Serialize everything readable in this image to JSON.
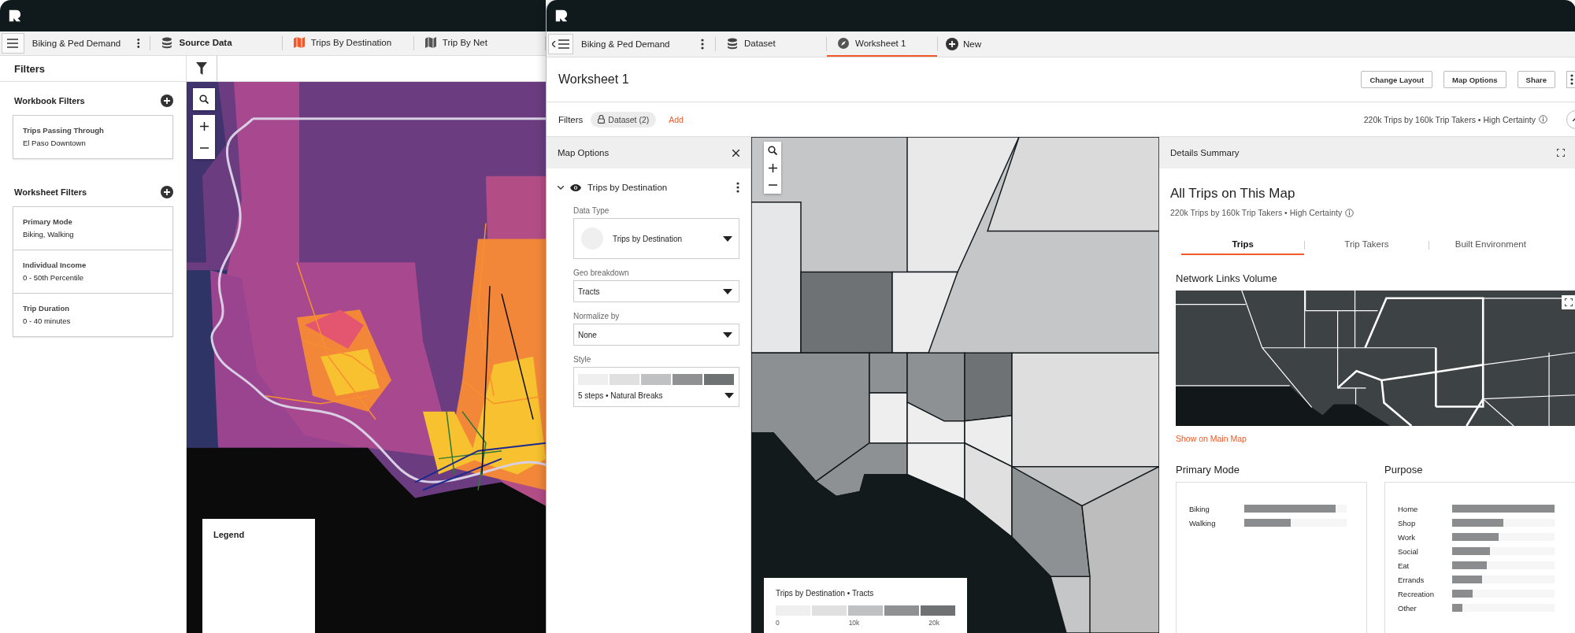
{
  "left_window": {
    "workbook_menu": {
      "title": "Biking & Ped Demand"
    },
    "tabs": [
      {
        "label": "Source Data",
        "kind": "database",
        "selected": true
      },
      {
        "label": "Trips By Destination",
        "kind": "map_colored",
        "selected": false
      },
      {
        "label": "Trip By Net",
        "kind": "map",
        "selected": false
      }
    ],
    "filters_panel": {
      "title": "Filters",
      "sections": [
        {
          "title": "Workbook Filters",
          "items": [
            {
              "name": "Trips Passing Through",
              "value": "El Paso Downtown"
            }
          ]
        },
        {
          "title": "Worksheet Filters",
          "items": [
            {
              "name": "Primary Mode",
              "value": "Biking, Walking"
            },
            {
              "name": "Individual Income",
              "value": "0 - 50th Percentile"
            },
            {
              "name": "Trip Duration",
              "value": "0 - 40 minutes"
            }
          ]
        }
      ]
    },
    "legend": {
      "title": "Legend"
    }
  },
  "right_window": {
    "workbook_menu": {
      "title": "Biking & Ped Demand"
    },
    "tabs": [
      {
        "label": "Dataset",
        "kind": "database",
        "selected": false
      },
      {
        "label": "Worksheet 1",
        "kind": "compass",
        "selected": true
      }
    ],
    "new_tab": {
      "label": "New"
    },
    "header": {
      "title": "Worksheet 1",
      "buttons": [
        "Change Layout",
        "Map Options",
        "Share"
      ]
    },
    "filters": {
      "label": "Filters",
      "chip": "Dataset (2)",
      "add": "Add",
      "summary": "220k Trips by 160k Trip Takers • High Certainty"
    },
    "map_options": {
      "title": "Map Options",
      "layer": {
        "name": "Trips by Destination",
        "expanded": true,
        "visible": true
      },
      "fields": [
        {
          "kind": "swatch",
          "label": "Data Type",
          "value": "Trips by Destination"
        },
        {
          "kind": "select",
          "label": "Geo breakdown",
          "value": "Tracts"
        },
        {
          "kind": "select",
          "label": "Normalize by",
          "value": "None"
        },
        {
          "kind": "ramp",
          "label": "Style",
          "value": "5 steps •  Natural Breaks",
          "steps": [
            {
              "color": "#efefef"
            },
            {
              "color": "#e0e0e0"
            },
            {
              "color": "#c0c1c2"
            },
            {
              "color": "#8f9193"
            },
            {
              "color": "#6f7273"
            }
          ]
        }
      ]
    },
    "map_legend": {
      "title": "Trips by Destination • Tracts",
      "steps": [
        {
          "color": "#efefef"
        },
        {
          "color": "#e0e0e0"
        },
        {
          "color": "#c0c1c2"
        },
        {
          "color": "#8f9193"
        },
        {
          "color": "#6f7273"
        }
      ],
      "ticks": [
        "0",
        "10k",
        "20k"
      ]
    },
    "details": {
      "title": "Details Summary",
      "heading": "All Trips on This Map",
      "summary": "220k Trips by 160k Trip Takers • High Certainty",
      "tabs": [
        {
          "label": "Trips",
          "selected": true
        },
        {
          "label": "Trip Takers",
          "selected": false
        },
        {
          "label": "Built Environment",
          "selected": false
        }
      ],
      "network": {
        "title": "Network Links Volume",
        "link": "Show on Main Map"
      },
      "panels": [
        {
          "title": "Primary Mode",
          "bars": [
            {
              "label": "Biking",
              "level": 0.89
            },
            {
              "label": "Walking",
              "level": 0.45
            }
          ]
        },
        {
          "title": "Purpose",
          "bars": [
            {
              "label": "Home",
              "level": 1.0
            },
            {
              "label": "Shop",
              "level": 0.5
            },
            {
              "label": "Work",
              "level": 0.45
            },
            {
              "label": "Social",
              "level": 0.37
            },
            {
              "label": "Eat",
              "level": 0.34
            },
            {
              "label": "Errands",
              "level": 0.29
            },
            {
              "label": "Recreation",
              "level": 0.2
            },
            {
              "label": "Other",
              "level": 0.1
            }
          ]
        }
      ]
    }
  }
}
